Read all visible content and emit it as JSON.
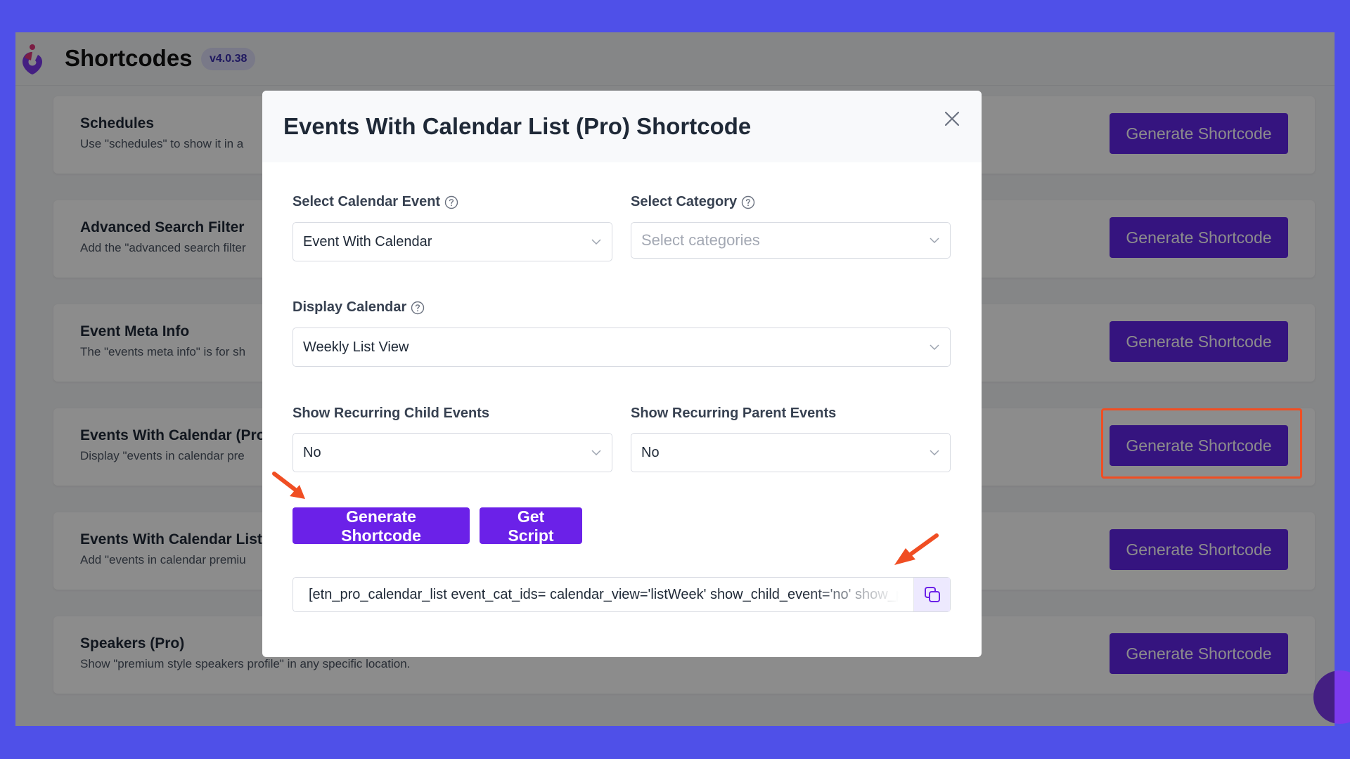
{
  "app": {
    "title": "Shortcodes",
    "version": "v4.0.38"
  },
  "cards": [
    {
      "title": "Schedules",
      "desc": "Use \"schedules\" to show it in a",
      "button": "Generate Shortcode"
    },
    {
      "title": "Advanced Search Filter",
      "desc": "Add the \"advanced search filter",
      "button": "Generate Shortcode"
    },
    {
      "title": "Event Meta Info",
      "desc": "The \"events meta info\" is for sh",
      "button": "Generate Shortcode"
    },
    {
      "title": "Events With Calendar (Pro)",
      "desc": "Display \"events in calendar pre",
      "button": "Generate Shortcode"
    },
    {
      "title": "Events With Calendar List (",
      "desc": "Add \"events in calendar premiu",
      "button": "Generate Shortcode"
    },
    {
      "title": "Speakers (Pro)",
      "desc": "Show \"premium style speakers profile\" in any specific location.",
      "button": "Generate Shortcode"
    }
  ],
  "modal": {
    "title": "Events With Calendar List (Pro) Shortcode",
    "fields": {
      "calendar_event": {
        "label": "Select Calendar Event",
        "value": "Event With Calendar"
      },
      "category": {
        "label": "Select Category",
        "placeholder": "Select categories"
      },
      "display_calendar": {
        "label": "Display Calendar",
        "value": "Weekly List View"
      },
      "recurring_child": {
        "label": "Show Recurring Child Events",
        "value": "No"
      },
      "recurring_parent": {
        "label": "Show Recurring Parent Events",
        "value": "No"
      }
    },
    "buttons": {
      "generate": "Generate Shortcode",
      "get_script": "Get Script"
    },
    "shortcode": "[etn_pro_calendar_list event_cat_ids= calendar_view='listWeek' show_child_event='no' show_parent_event='no']"
  },
  "colors": {
    "background": "#4f50e8",
    "primary": "#6b21e8",
    "highlight": "#f04e23"
  },
  "icons": {
    "close": "close-icon",
    "help": "help-circle-icon",
    "chevron": "chevron-down-icon",
    "copy": "copy-icon"
  }
}
